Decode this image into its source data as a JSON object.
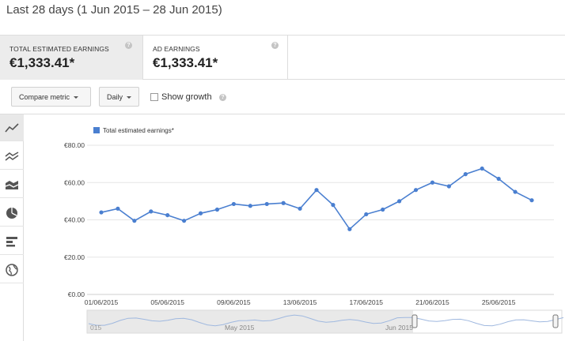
{
  "header": {
    "title": "Last 28 days (1 Jun 2015 – 28 Jun 2015)"
  },
  "metrics": [
    {
      "label": "TOTAL ESTIMATED EARNINGS",
      "value": "€1,333.41*",
      "help": "?"
    },
    {
      "label": "AD EARNINGS",
      "value": "€1,333.41*",
      "help": "?"
    }
  ],
  "toolbar": {
    "compare_metric": "Compare metric",
    "granularity": "Daily",
    "show_growth": "Show growth",
    "help": "?"
  },
  "tools": [
    "line-chart-icon",
    "multi-line-chart-icon",
    "stacked-area-chart-icon",
    "pie-chart-icon",
    "bar-chart-icon",
    "globe-map-icon"
  ],
  "chart_data": {
    "type": "line",
    "series": [
      {
        "name": "Total estimated earnings*",
        "color": "#4a7fd0",
        "values": [
          44,
          46,
          39.5,
          44.5,
          42.5,
          39.5,
          43.5,
          45.5,
          48.5,
          47.5,
          48.5,
          49,
          46,
          56,
          48,
          35,
          43,
          45.5,
          50,
          56,
          60,
          58,
          64.5,
          67.5,
          62,
          55,
          50.5
        ]
      }
    ],
    "x": [
      "01/06/2015",
      "02/06/2015",
      "03/06/2015",
      "04/06/2015",
      "05/06/2015",
      "06/06/2015",
      "07/06/2015",
      "08/06/2015",
      "09/06/2015",
      "10/06/2015",
      "11/06/2015",
      "12/06/2015",
      "13/06/2015",
      "14/06/2015",
      "15/06/2015",
      "16/06/2015",
      "17/06/2015",
      "18/06/2015",
      "19/06/2015",
      "20/06/2015",
      "21/06/2015",
      "22/06/2015",
      "23/06/2015",
      "24/06/2015",
      "25/06/2015",
      "26/06/2015",
      "27/06/2015"
    ],
    "x_tick_labels": [
      "01/06/2015",
      "05/06/2015",
      "09/06/2015",
      "13/06/2015",
      "17/06/2015",
      "21/06/2015",
      "25/06/2015"
    ],
    "y_tick_labels": [
      "€0.00",
      "€20.00",
      "€40.00",
      "€60.00",
      "€80.00"
    ],
    "y_ticks": [
      0,
      20,
      40,
      60,
      80
    ],
    "ylim": [
      0,
      80
    ],
    "grid": true,
    "legend": "top-left",
    "navigator": {
      "labels": [
        "May 2015",
        "Jun 2015"
      ],
      "left_fragment": "015"
    }
  }
}
